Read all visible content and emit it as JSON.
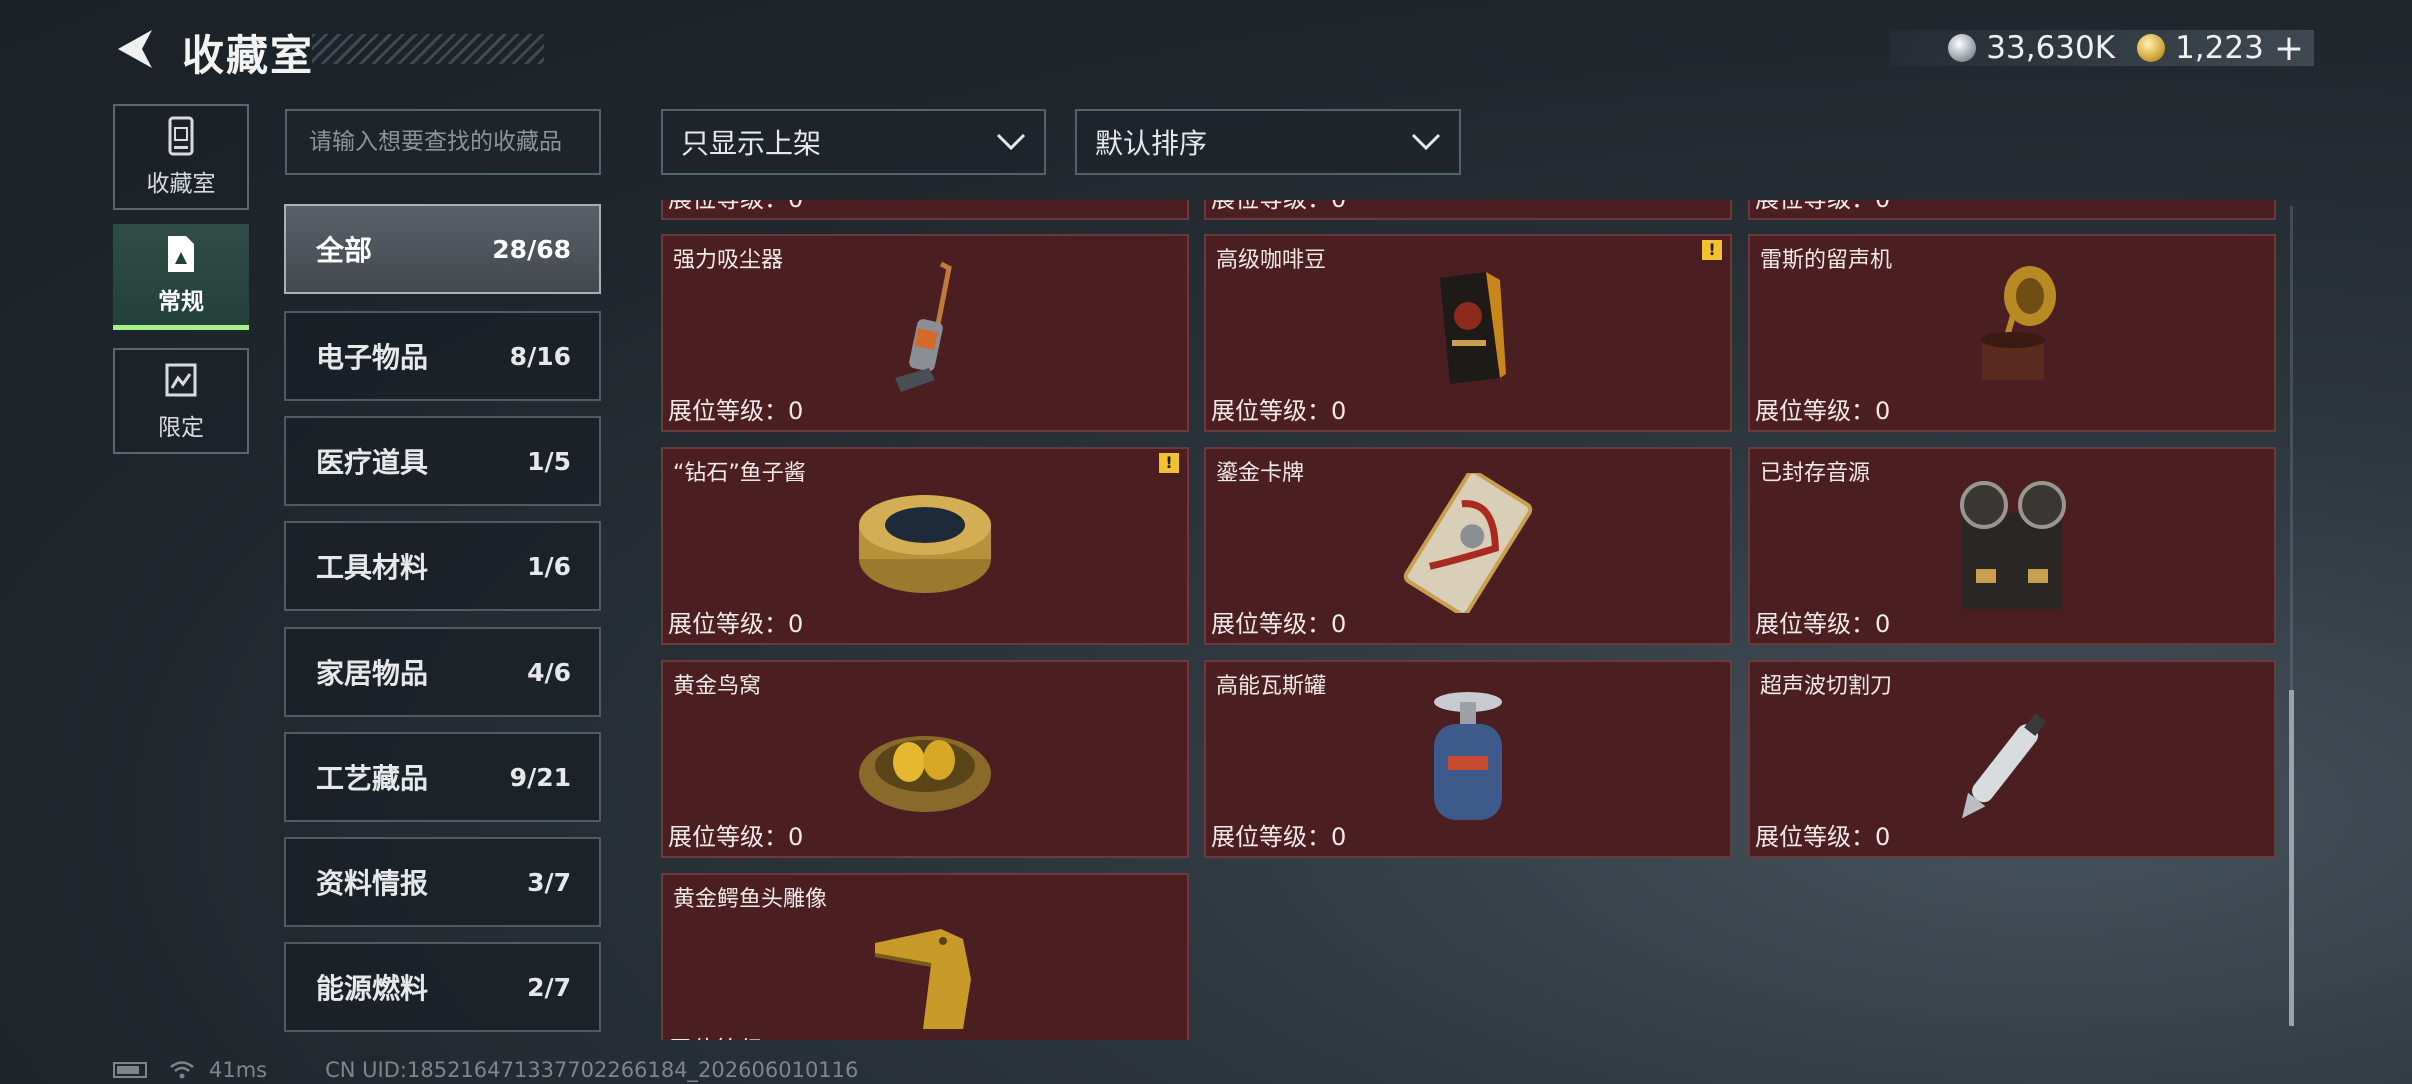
{
  "header": {
    "title": "收藏室",
    "silver": "33,630K",
    "gold": "1,223",
    "plus": "+"
  },
  "nav": [
    {
      "label": "收藏室",
      "icon": "collection-room-icon"
    },
    {
      "label": "常规",
      "icon": "regular-icon",
      "active": true
    },
    {
      "label": "限定",
      "icon": "limited-icon"
    }
  ],
  "search": {
    "placeholder": "请输入想要查找的收藏品"
  },
  "filters": {
    "shelf": "只显示上架",
    "sort": "默认排序"
  },
  "categories": [
    {
      "label": "全部",
      "count": "28/68",
      "active": true
    },
    {
      "label": "电子物品",
      "count": "8/16"
    },
    {
      "label": "医疗道具",
      "count": "1/5"
    },
    {
      "label": "工具材料",
      "count": "1/6"
    },
    {
      "label": "家居物品",
      "count": "4/6"
    },
    {
      "label": "工艺藏品",
      "count": "9/21"
    },
    {
      "label": "资料情报",
      "count": "3/7"
    },
    {
      "label": "能源燃料",
      "count": "2/7"
    }
  ],
  "level_label": "展位等级：0",
  "items": [
    {
      "name": "",
      "icon": "partial-item"
    },
    {
      "name": "",
      "icon": "partial-item"
    },
    {
      "name": "",
      "icon": "partial-item"
    },
    {
      "name": "强力吸尘器",
      "icon": "vacuum-cleaner-icon"
    },
    {
      "name": "高级咖啡豆",
      "icon": "coffee-beans-icon",
      "warning": true
    },
    {
      "name": "雷斯的留声机",
      "icon": "gramophone-icon"
    },
    {
      "name": "“钻石”鱼子酱",
      "icon": "caviar-tin-icon",
      "warning": true
    },
    {
      "name": "鎏金卡牌",
      "icon": "gilded-card-icon"
    },
    {
      "name": "已封存音源",
      "icon": "reel-recorder-icon"
    },
    {
      "name": "黄金鸟窝",
      "icon": "golden-nest-icon"
    },
    {
      "name": "高能瓦斯罐",
      "icon": "gas-canister-icon"
    },
    {
      "name": "超声波切割刀",
      "icon": "ultrasonic-cutter-icon"
    },
    {
      "name": "黄金鳄鱼头雕像",
      "icon": "crocodile-statue-icon"
    }
  ],
  "warning_mark": "!",
  "footer": {
    "ping": "41ms",
    "uid": "CN UID:18521647133770226618​4_202606010116"
  }
}
